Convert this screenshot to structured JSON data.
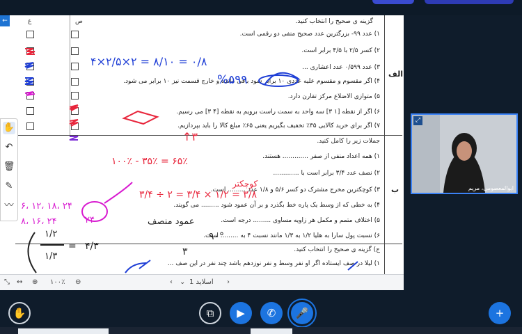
{
  "slide": {
    "top_instruction": "گزینه ی صحیح را انتخاب کنید.",
    "col_false": "غ",
    "col_true": "ص",
    "section_a_label": "الف",
    "section_b_label": "ب",
    "part_a_items": [
      "۱) عدد ۹۹- بزرگترین عدد صحیح منفی دو رقمی است.",
      "۲) کسر ۲/۵ با ۴/۵ برابر است.",
      "۳) عدد ۰/۵۹۹ عدد اعشاری ...",
      "۴) اگر مقسوم و مقسوم علیه عددی ۱۰ برابر شود باقی مانده و خارج قسمت نیز ۱۰ برابر می شود.",
      "۵) متوازی الاضلاع مرکز تقارن دارد.",
      "۶) اگر از نقطه [۱ ۳] سه واحد به سمت راست برویم به نقطه [۴ ۳] می رسیم.",
      "۷) اگر برای خرید کالایی ۳۵٪ تخفیف بگیریم یعنی ۶۵٪ مبلغ کالا را باید بپردازیم."
    ],
    "part_b_instruction": "جملات زیر را کامل کنید.",
    "part_b_items": [
      "۱) همه اعداد منفی از صفر ............. هستند.",
      "۲) نصف عدد ۳/۴ برابر است با .............",
      "۳) کوچکترین مخرج مشترک دو کسر ۵/۶ و ۱/۸ عدد ......... است.",
      "۴) به خطی که از وسط یک پاره خط بگذرد و بر آن عمود شود ......... می گویند.",
      "۵) اختلاف متمم و مکمل هر زاویه مساوی ......... درجه است.",
      "۶) نسبت پول سارا به هلیا ۱/۲ به ۱/۳ مانند نسبت ۴ به ......... است."
    ],
    "part_c_instruction": "ج) گزینه ی صحیح را انتخاب کنید.",
    "part_c_item": "۱) لیلا در صف ایستاده اگر او نفر وسط و نفر نوزدهم باشد چند نفر در این صف ..."
  },
  "annotations": {
    "frac_work": "۴×۲/۵×۲ = ۸/۱۰ = ۰/۸",
    "frac_result": "%۵۹۹",
    "percent_work": "۱۰۰٪ - ۳۵٪ = ۶۵٪",
    "half_work": "۳/۴ ÷ ۲ = ۳/۴ × ۱/۲ = ۳/۸",
    "multiples_top": "۶، ۱۲، ۱۸، ۲۴",
    "multiples_bottom": "۸، ۱۶، ۲۴",
    "answer_24": "۲۴",
    "answer_90": "۹۰°",
    "answer_3": "۳",
    "answer_negative": "کوچکتر",
    "answer_bisector": "عمود منصف",
    "ratio_lhs_top": "۱/۲",
    "ratio_lhs_bottom": "۱/۳",
    "ratio_rhs": "۴/۳"
  },
  "navbar": {
    "slide_label": "اسلاید 1",
    "zoom": "۱۰۰٪"
  },
  "webcam": {
    "name": "ابوالمعصومی، مریم"
  },
  "colors": {
    "accent": "#1c74e0",
    "pen_red": "#e8253b",
    "pen_blue": "#1f3fd6",
    "pen_magenta": "#d81bd0",
    "pen_purple": "#7b2bd6"
  }
}
